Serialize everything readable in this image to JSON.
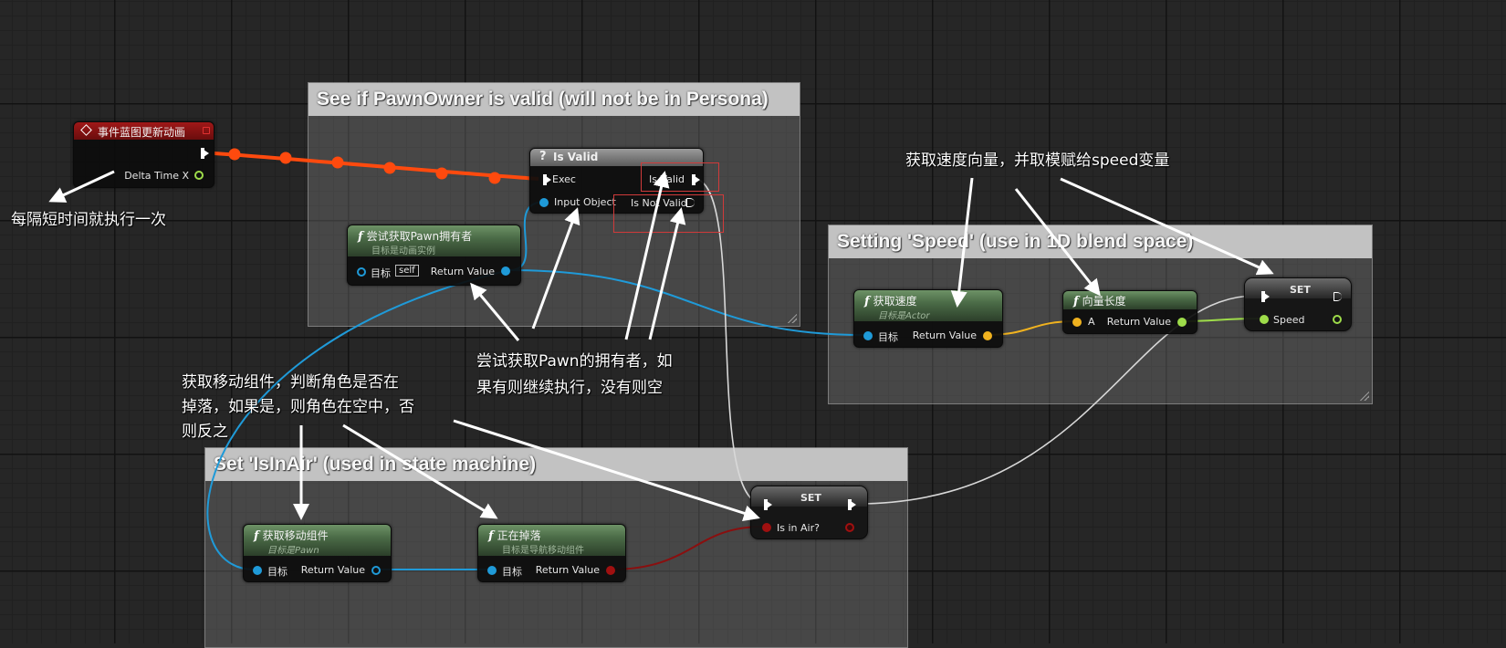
{
  "colors": {
    "exec_wire": "#ff4a0e",
    "object_wire": "#1f9ad8",
    "float_wire": "#9edc4a",
    "bool_wire": "#8a0f0f",
    "vector_wire": "#f0b21f",
    "exec_wire_white": "#d8d8d8"
  },
  "comments": [
    {
      "title": "See if PawnOwner is valid (will not be in Persona)"
    },
    {
      "title": "Setting 'Speed' (use in 1D blend space)"
    },
    {
      "title": "Set 'IsInAir' (used in state machine)"
    }
  ],
  "nodes": {
    "event": {
      "title": "事件蓝图更新动画",
      "icon": "diamond-event-icon",
      "pin_delta": "Delta Time X"
    },
    "isvalid": {
      "title": "Is Valid",
      "icon": "question-icon",
      "exec": "Exec",
      "is_valid": "Is Valid",
      "input_object": "Input Object",
      "is_not_valid": "Is Not Valid"
    },
    "try_get_pawn": {
      "title": "尝试获取Pawn拥有者",
      "subtitle": "目标是动画实例",
      "target": "目标",
      "self_tag": "self",
      "return": "Return Value"
    },
    "get_velocity": {
      "title": "获取速度",
      "subtitle": "目标是Actor",
      "target": "目标",
      "return": "Return Value"
    },
    "vector_length": {
      "title": "向量长度",
      "pin_a": "A",
      "return": "Return Value"
    },
    "set_speed": {
      "title": "SET",
      "pin": "Speed"
    },
    "get_movement": {
      "title": "获取移动组件",
      "subtitle": "目标是Pawn",
      "target": "目标",
      "return": "Return Value"
    },
    "is_falling": {
      "title": "正在掉落",
      "subtitle": "目标是导航移动组件",
      "target": "目标",
      "return": "Return Value"
    },
    "set_inair": {
      "title": "SET",
      "pin": "Is in Air?"
    }
  },
  "notes": {
    "tick": "每隔短时间就执行一次",
    "velocity_l1": "获取速度向量，并取模赋给speed变量",
    "pawn_l1": "尝试获取Pawn的拥有者，如",
    "pawn_l2": "果有则继续执行，没有则空",
    "move_l1": "获取移动组件，判断角色是否在",
    "move_l2": "掉落，如果是，则角色在空中，否",
    "move_l3": "则反之"
  }
}
